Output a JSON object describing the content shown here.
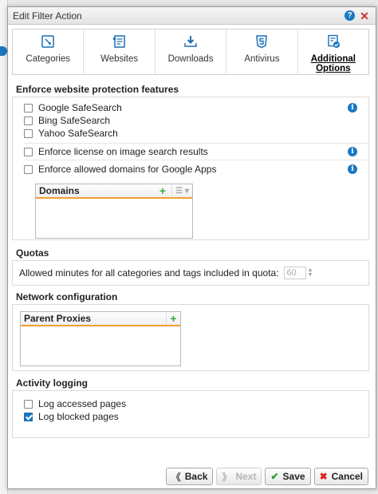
{
  "dialog": {
    "title": "Edit Filter Action",
    "help_glyph": "?",
    "close_glyph": "✕"
  },
  "tabs": [
    {
      "label": "Categories",
      "icon": "categories-icon"
    },
    {
      "label": "Websites",
      "icon": "websites-icon"
    },
    {
      "label": "Downloads",
      "icon": "downloads-icon"
    },
    {
      "label": "Antivirus",
      "icon": "antivirus-icon"
    },
    {
      "label_line1": "Additional",
      "label_line2": "Options",
      "icon": "additional-options-icon",
      "active": true
    }
  ],
  "protection": {
    "title": "Enforce website protection features",
    "google": "Google SafeSearch",
    "bing": "Bing SafeSearch",
    "yahoo": "Yahoo SafeSearch",
    "license": "Enforce license on image search results",
    "domains_enforce": "Enforce allowed domains for Google Apps",
    "domains_grid_title": "Domains"
  },
  "quotas": {
    "title": "Quotas",
    "label": "Allowed minutes for all categories and tags included in quota:",
    "value": "60"
  },
  "network": {
    "title": "Network configuration",
    "grid_title": "Parent Proxies"
  },
  "logging": {
    "title": "Activity logging",
    "accessed": "Log accessed pages",
    "blocked": "Log blocked pages"
  },
  "footer": {
    "back": "Back",
    "next": "Next",
    "save": "Save",
    "cancel": "Cancel"
  },
  "colors": {
    "accent": "#1a78c2",
    "grid_underline": "#f0a030",
    "add_green": "#3aa83a"
  }
}
